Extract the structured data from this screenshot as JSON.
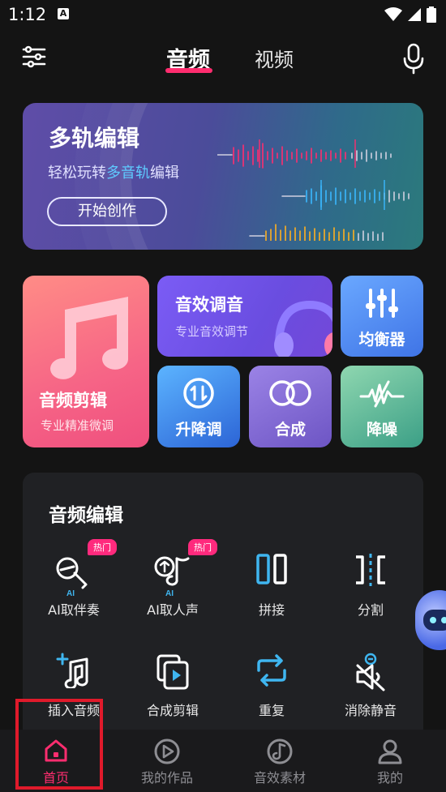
{
  "status_bar": {
    "time": "1:12",
    "a_icon": "A"
  },
  "header": {
    "tab_audio": "音频",
    "tab_video": "视频"
  },
  "banner": {
    "title": "多轨编辑",
    "subtitle_prefix": "轻松玩转",
    "subtitle_highlight": "多音轨",
    "subtitle_suffix": "编辑",
    "cta": "开始创作"
  },
  "tiles": {
    "edit": {
      "title": "音频剪辑",
      "subtitle": "专业精准微调"
    },
    "effect": {
      "title": "音效调音",
      "subtitle": "专业音效调节"
    },
    "eq": {
      "title": "均衡器"
    },
    "pitch": {
      "title": "升降调"
    },
    "mix": {
      "title": "合成"
    },
    "denoise": {
      "title": "降噪"
    }
  },
  "panel": {
    "title": "音频编辑",
    "hot_badge": "热门",
    "ai_tag": "AI",
    "tools": [
      {
        "label": "AI取伴奏"
      },
      {
        "label": "AI取人声"
      },
      {
        "label": "拼接"
      },
      {
        "label": "分割"
      },
      {
        "label": "插入音频"
      },
      {
        "label": "合成剪辑"
      },
      {
        "label": "重复"
      },
      {
        "label": "消除静音"
      }
    ]
  },
  "nav": {
    "items": [
      {
        "label": "首页"
      },
      {
        "label": "我的作品"
      },
      {
        "label": "音效素材"
      },
      {
        "label": "我的"
      }
    ]
  },
  "colors": {
    "accent": "#ff2d6f",
    "highlight_blue": "#5ecbff",
    "tool_blue": "#3fb6f0",
    "hot_badge": "#ff2a7d"
  }
}
